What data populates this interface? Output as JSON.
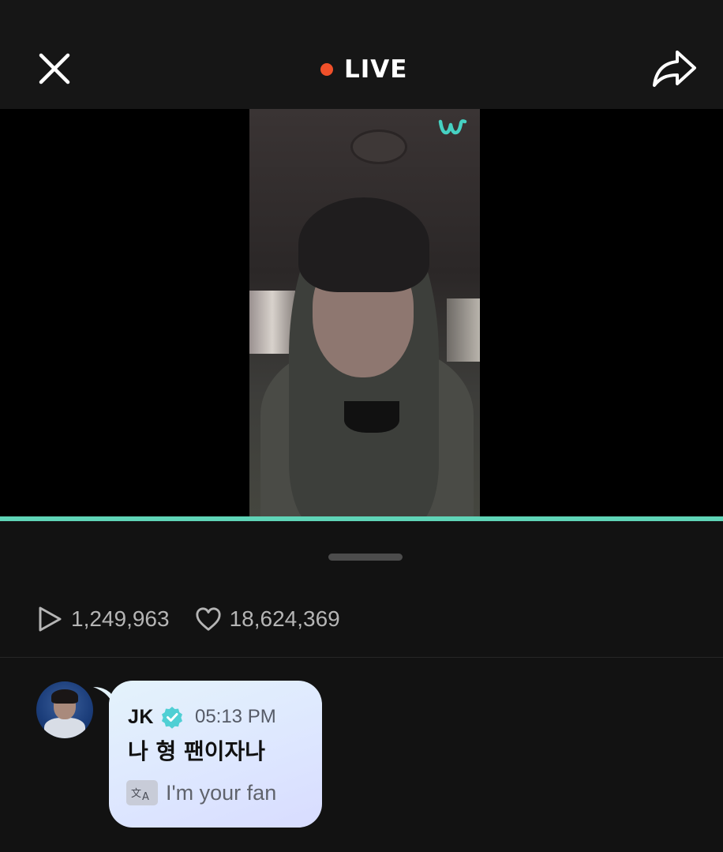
{
  "header": {
    "live_label": "LIVE",
    "close_icon": "close-icon",
    "share_icon": "share-icon",
    "live_dot_color": "#f0502a"
  },
  "player": {
    "watermark_icon": "weverse-logo-icon",
    "progress_color": "#5fd4b7"
  },
  "stats": {
    "plays": "1,249,963",
    "likes": "18,624,369",
    "plays_icon": "play-icon",
    "likes_icon": "heart-icon"
  },
  "comment": {
    "author": "JK",
    "verified_icon": "verified-badge-icon",
    "time": "05:13 PM",
    "text": "나 형 팬이자나",
    "translate_icon": "translate-icon",
    "translation": "I'm your fan"
  }
}
